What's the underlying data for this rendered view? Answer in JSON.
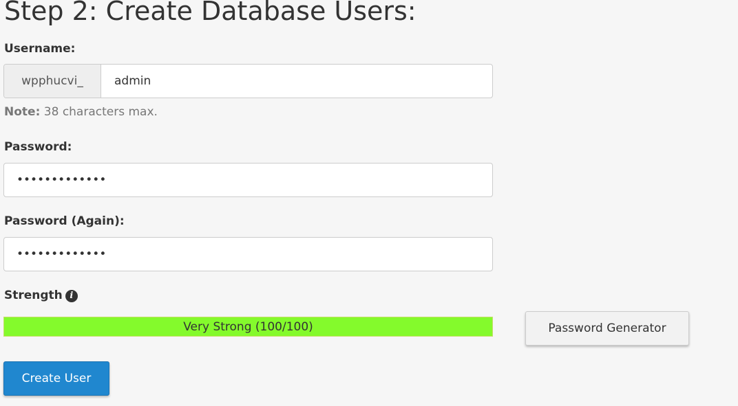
{
  "heading": "Step 2: Create Database Users:",
  "username": {
    "label": "Username:",
    "prefix": "wpphucvi_",
    "value": "admin"
  },
  "note": {
    "bold": "Note:",
    "text": " 38 characters max."
  },
  "password": {
    "label": "Password:",
    "value": "•••••••••••••"
  },
  "password_again": {
    "label": "Password (Again):",
    "value": "•••••••••••••"
  },
  "strength": {
    "label": "Strength",
    "icon": "info-circle-icon",
    "text": "Very Strong (100/100)",
    "score": 100,
    "max": 100,
    "bar_color": "#84fa2c"
  },
  "buttons": {
    "generator": "Password Generator",
    "create": "Create User"
  },
  "colors": {
    "primary": "#2087cf",
    "background": "#f6f6f6"
  }
}
